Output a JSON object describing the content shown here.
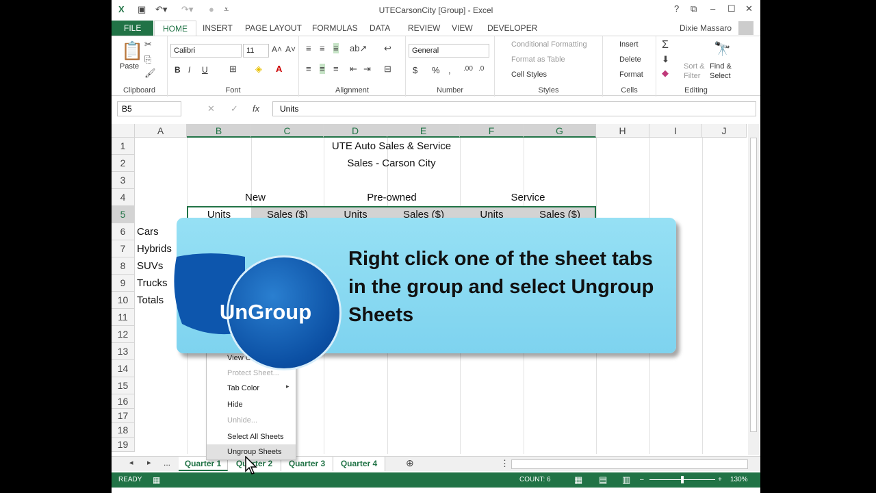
{
  "window": {
    "title": "UTECarsonCity [Group] - Excel",
    "user": "Dixie Massaro",
    "help": "?"
  },
  "ribbon_tabs": [
    "FILE",
    "HOME",
    "INSERT",
    "PAGE LAYOUT",
    "FORMULAS",
    "DATA",
    "REVIEW",
    "VIEW",
    "DEVELOPER"
  ],
  "clipboard": {
    "paste": "Paste",
    "label": "Clipboard"
  },
  "font": {
    "name": "Calibri",
    "size": "11",
    "bold": "B",
    "italic": "I",
    "underline": "U",
    "label": "Font"
  },
  "alignment": {
    "label": "Alignment"
  },
  "number": {
    "format": "General",
    "currency": "$",
    "percent": "%",
    "comma": ",",
    "label": "Number"
  },
  "styles": {
    "cond": "Conditional Formatting",
    "table": "Format as Table",
    "cell": "Cell Styles",
    "label": "Styles"
  },
  "cells": {
    "insert": "Insert",
    "delete": "Delete",
    "format": "Format",
    "label": "Cells"
  },
  "editing": {
    "sort": "Sort &",
    "filter": "Filter",
    "find": "Find &",
    "select": "Select",
    "label": "Editing"
  },
  "formula_bar": {
    "namebox": "B5",
    "fx": "fx",
    "value": "Units"
  },
  "columns": [
    "A",
    "B",
    "C",
    "D",
    "E",
    "F",
    "G",
    "H",
    "I",
    "J"
  ],
  "rows": [
    "1",
    "2",
    "3",
    "4",
    "5",
    "6",
    "7",
    "8",
    "9",
    "10",
    "11",
    "12",
    "13",
    "14",
    "15",
    "16",
    "17",
    "18",
    "19"
  ],
  "cells_text": {
    "r1": "UTE Auto Sales & Service",
    "r2": "Sales - Carson City",
    "new": "New",
    "preowned": "Pre-owned",
    "service": "Service",
    "units1": "Units",
    "sales1": "Sales ($)",
    "units2": "Units",
    "sales2": "Sales ($)",
    "units3": "Units",
    "sales3": "Sales ($)",
    "cars": "Cars",
    "hybrids": "Hybrids",
    "suvs": "SUVs",
    "trucks": "Trucks",
    "totals": "Totals"
  },
  "context_menu": [
    "View Code",
    "Protect Sheet...",
    "Tab Color",
    "Hide",
    "Unhide...",
    "Select All Sheets",
    "Ungroup Sheets"
  ],
  "sheet_tabs": [
    "...",
    "Quarter 1",
    "Quarter 2",
    "Quarter 3",
    "Quarter 4"
  ],
  "status": {
    "ready": "READY",
    "count": "COUNT: 6",
    "zoom": "130%"
  },
  "callout": {
    "badge": "UnGroup",
    "text": "Right click one of the sheet tabs in the group and select Ungroup Sheets"
  },
  "colors": {
    "accent": "#217346",
    "callout": "#8fdcf2",
    "badge": "#0b4fa3"
  }
}
